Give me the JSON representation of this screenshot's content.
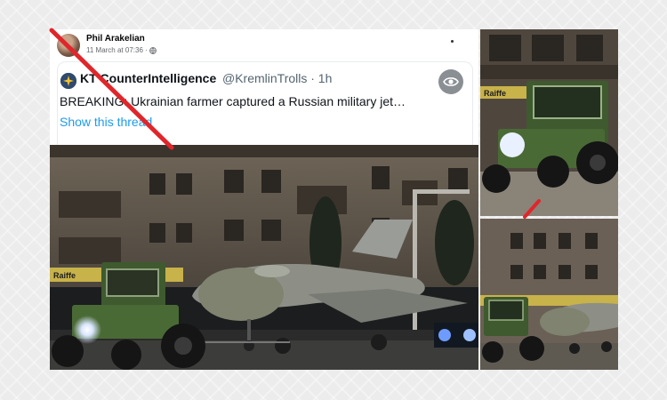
{
  "post": {
    "author": "Phil Arakelian",
    "timestamp": "11 March at 07:36 ·",
    "privacy_icon": "globe-icon",
    "menu_icon": "more-options-icon"
  },
  "tweet": {
    "display_name": "KT CounterIntelligence",
    "handle": "@KremlinTrolls · 1h",
    "text": "BREAKING: Ukrainian farmer captured a Russian military jet…",
    "show_thread": "Show this thread",
    "view_icon": "eye-icon"
  },
  "photo": {
    "shop_sign": "Raiffe"
  },
  "colors": {
    "strike_red": "#e0262b",
    "link_blue": "#1d9bf0",
    "tractor_green": "#3e5a2e",
    "night_sky": "#1b1d1f"
  }
}
